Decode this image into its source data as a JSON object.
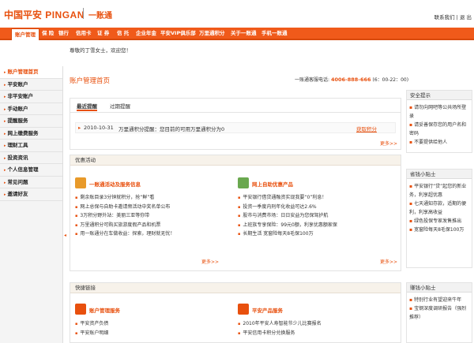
{
  "brand": {
    "logo_cn": "中国平安",
    "logo_en": "PINGAN",
    "sub": "一账通"
  },
  "top_links": "联系我们 | 退 出",
  "nav": [
    {
      "label": "账户管理"
    },
    {
      "label": "保 险"
    },
    {
      "label": "银行"
    },
    {
      "label": "信用卡"
    },
    {
      "label": "证 券"
    },
    {
      "label": "信 托"
    },
    {
      "label": "企业年金"
    },
    {
      "label": "平安VIP俱乐部"
    },
    {
      "label": "万里通积分"
    },
    {
      "label": "关于一账通"
    },
    {
      "label": "手机一账通"
    }
  ],
  "welcome": "尊敬的丁雪女士，欢迎您！",
  "sidebar": [
    "账户管理首页",
    "平安账户",
    "非平安账户",
    "手动账户",
    "提醒服务",
    "网上缴费服务",
    "理财工具",
    "投资资讯",
    "个人信息管理",
    "常见问题",
    "邀请好友"
  ],
  "main": {
    "title": "账户管理首页",
    "hotline_label": "一账通客服电话:",
    "hotline": "4006-888-666",
    "hotline_hours": "(6：00-22：00)",
    "tabs": [
      "最近提醒",
      "过期提醒"
    ],
    "reminder": {
      "date": "2010-10-31",
      "text": "万里通积分提醒：您目前的可用万里通积分为0",
      "action": "获取积分"
    },
    "more": "更多>>",
    "promo_head": "优惠活动",
    "promo_left_title": "一账通活动及服务信息",
    "promo_left": [
      "剩余账目录3分钟就积分，抢“鲜”看",
      "网上总保与自助卡邀请频活动中奖名单公布",
      "3万积分野外站：美丽三亚等你带",
      "万里通积分可购买旅游度假产品和机票",
      "用一账通分在车做收益：探索，理财就无忧！"
    ],
    "promo_right_title": "网上自助优惠产品",
    "promo_right": [
      "平安银行借贷通融资实现我要“0”利息！",
      "投资一季度内刑年化收益可达2.6%",
      "股市与消费市场：日日安益为您保驾护航",
      "上班族专享保险：99元0额，利享优惠额家保",
      "长期生活 宽窗险每天8毛保100万"
    ],
    "quick_head": "快捷链接",
    "quick_left_title": "账户管理服务",
    "quick_left": [
      "平安资产负债",
      "平安账户明细"
    ],
    "quick_right_title": "平安产品服务",
    "quick_right": [
      "2010年平安人寿智能节少儿比赛报名",
      "平安信用卡积分兑换服务"
    ]
  },
  "right": {
    "security_head": "安全提示",
    "security": [
      "请勿向网吧等公共场所登录",
      "请妥善保存您的用户名和密码",
      "不要提供给他人"
    ],
    "tips_head": "省钱小贴士",
    "tips": [
      "平安银行“贷”起您的新业务，利享超优惠",
      "七天通知存款，适期的便利，利享高收益",
      "绿色投保专家发售推出",
      "宽窗险每天8毛保100万"
    ],
    "finance_head": "赚钱小贴士",
    "finance": [
      "特别行业有望迎来牛年",
      "宝钢深度调研报告（强烈推荐）"
    ]
  }
}
